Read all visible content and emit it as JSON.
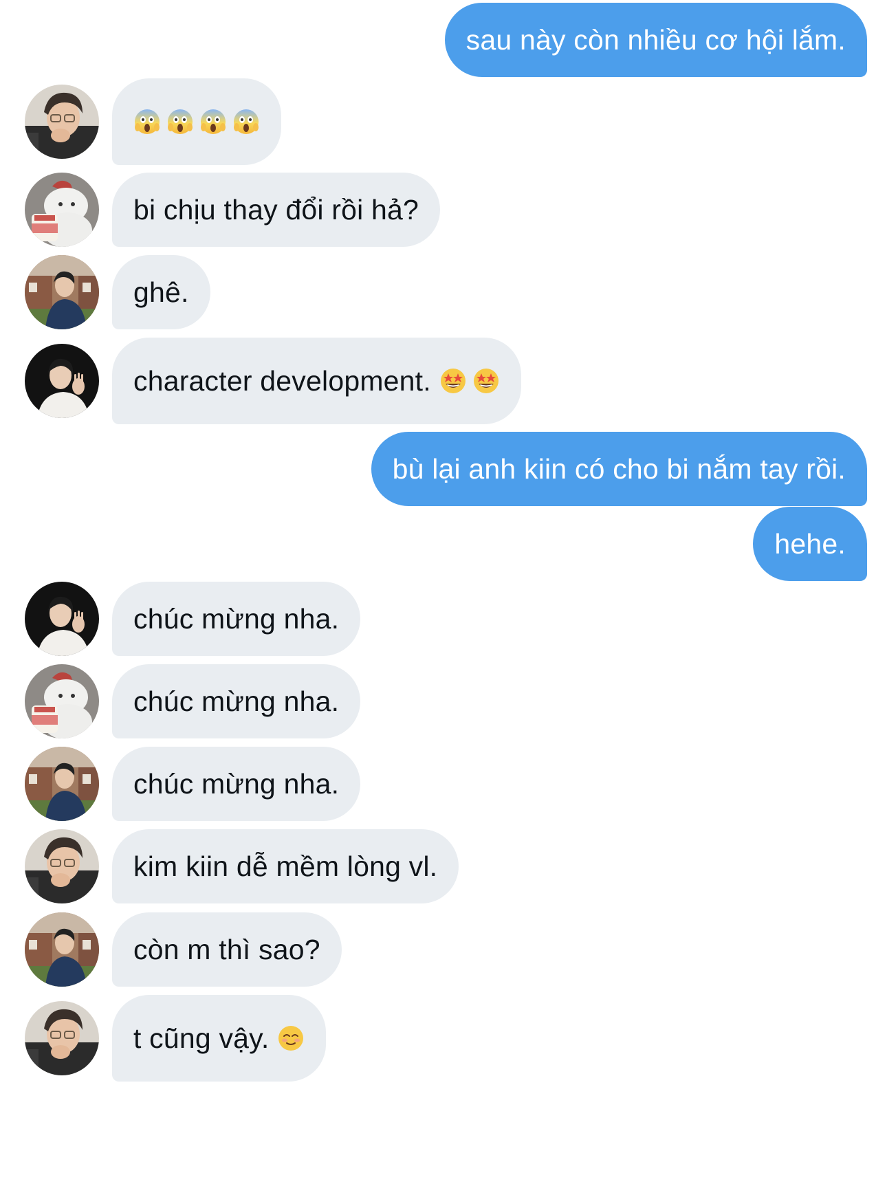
{
  "conversation": {
    "messages": [
      {
        "side": "out",
        "text": "sau này còn nhiều cơ hội lắm."
      },
      {
        "side": "in",
        "avatar": "guy-glasses",
        "text": "",
        "emojis": [
          "scream-emoji",
          "scream-emoji",
          "scream-emoji",
          "scream-emoji"
        ]
      },
      {
        "side": "in",
        "avatar": "bear-cartoon",
        "text": "bi chịu thay đổi rồi hả?"
      },
      {
        "side": "in",
        "avatar": "guy-street",
        "text": "ghê."
      },
      {
        "side": "in",
        "avatar": "guy-dark",
        "text": "character development.",
        "emojis": [
          "star-struck-emoji",
          "star-struck-emoji"
        ]
      },
      {
        "side": "out",
        "text": "bù lại anh kiin có cho bi nắm tay rồi."
      },
      {
        "side": "out",
        "text": "hehe."
      },
      {
        "side": "in",
        "avatar": "guy-dark",
        "text": "chúc mừng nha."
      },
      {
        "side": "in",
        "avatar": "bear-cartoon",
        "text": "chúc mừng nha."
      },
      {
        "side": "in",
        "avatar": "guy-street",
        "text": "chúc mừng nha."
      },
      {
        "side": "in",
        "avatar": "guy-glasses",
        "text": "kim kiin dễ mềm lòng vl."
      },
      {
        "side": "in",
        "avatar": "guy-street",
        "text": "còn m thì sao?"
      },
      {
        "side": "in",
        "avatar": "guy-glasses",
        "text": "t cũng vậy.",
        "emojis": [
          "smiling-blush-emoji"
        ]
      }
    ]
  },
  "colors": {
    "outgoing_bubble": "#4c9eeb",
    "incoming_bubble": "#e9edf1",
    "incoming_text": "#0f1419",
    "outgoing_text": "#ffffff"
  }
}
